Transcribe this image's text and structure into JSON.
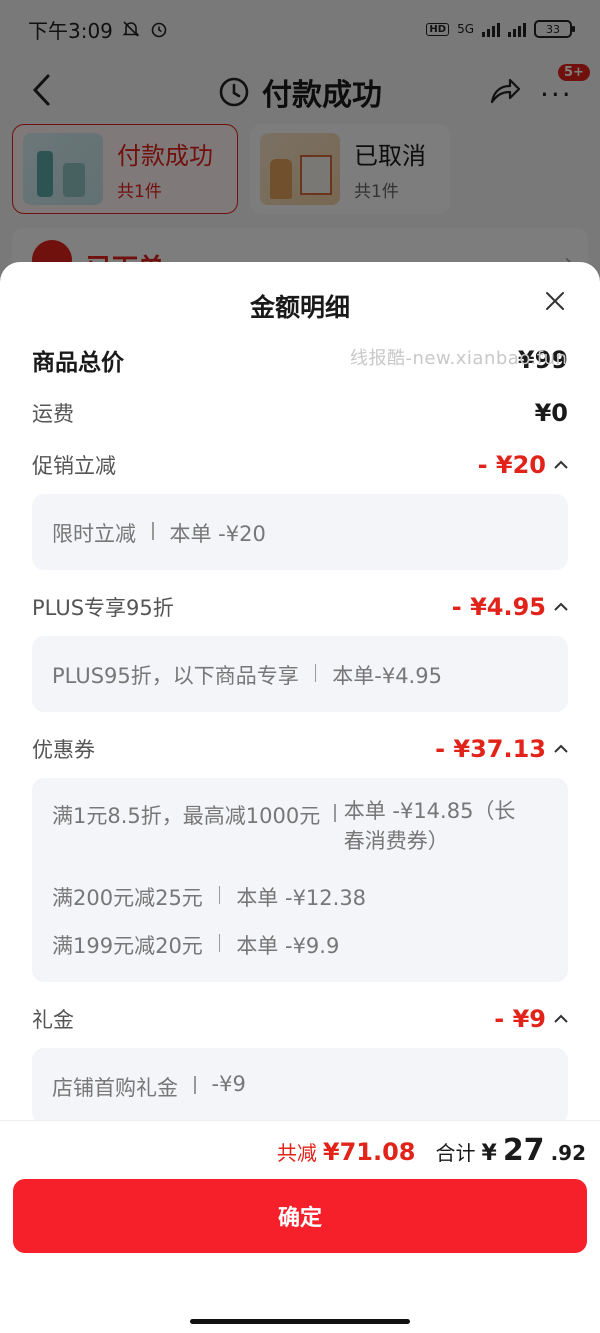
{
  "status_bar": {
    "time": "下午3:09",
    "network": "5G",
    "battery": "33"
  },
  "nav": {
    "title": "付款成功",
    "more": "···",
    "badge": "5+"
  },
  "order_tabs": [
    {
      "name": "付款成功",
      "count": "共1件"
    },
    {
      "name": "已取消",
      "count": "共1件"
    }
  ],
  "peek": {
    "label": "已下单"
  },
  "sheet": {
    "title": "金额明细",
    "watermark": "线报酷-new.xianbao.fun",
    "total_price": {
      "label": "商品总价",
      "value": "¥99"
    },
    "shipping": {
      "label": "运费",
      "value": "¥0"
    },
    "promo": {
      "label": "促销立减",
      "value": "- ¥20",
      "items": [
        {
          "name": "限时立减",
          "amount": "本单 -¥20"
        }
      ]
    },
    "plus": {
      "label": "PLUS专享95折",
      "value": "- ¥4.95",
      "items": [
        {
          "name": "PLUS95折，以下商品专享",
          "amount": "本单-¥4.95"
        }
      ]
    },
    "coupon": {
      "label": "优惠券",
      "value": "- ¥37.13",
      "items": [
        {
          "name": "满1元8.5折，最高减1000元",
          "amount_line1": "本单 -¥14.85（长",
          "amount_line2": "春消费券）"
        },
        {
          "name": "满200元减25元",
          "amount": "本单 -¥12.38"
        },
        {
          "name": "满199元减20元",
          "amount": "本单 -¥9.9"
        }
      ]
    },
    "gift": {
      "label": "礼金",
      "value": "- ¥9",
      "items": [
        {
          "name": "店铺首购礼金",
          "amount": "-¥9"
        }
      ]
    }
  },
  "footer": {
    "discount_label": "共减",
    "discount_value": "¥71.08",
    "total_label": "合计",
    "total_yen": "¥",
    "total_int": "27",
    "total_dec": ".92",
    "confirm_label": "确定"
  },
  "colors": {
    "accent": "#e2231a",
    "button": "#f6202b",
    "detail_bg": "#f4f5f9"
  }
}
